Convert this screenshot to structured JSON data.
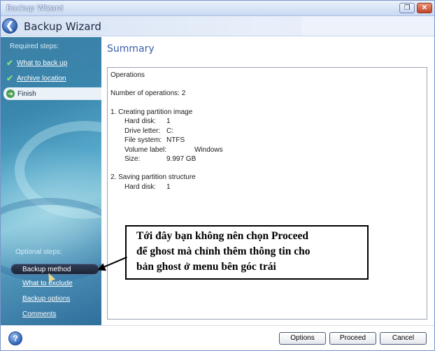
{
  "window": {
    "title": "Backup Wizard",
    "controls": {
      "restore": "❐",
      "close": "✕"
    }
  },
  "header": {
    "title": "Backup Wizard",
    "back_icon": "back-arrow-icon",
    "back_glyph": "❮"
  },
  "sidebar": {
    "required_label": "Required steps:",
    "required_items": [
      {
        "label": "What to back up",
        "icon": "check-icon"
      },
      {
        "label": "Archive location",
        "icon": "check-icon"
      }
    ],
    "current_step": {
      "label": "Finish",
      "icon": "arrow-right-icon",
      "glyph": "➜"
    },
    "optional_label": "Optional steps:",
    "optional_items": [
      {
        "label": "Backup method",
        "selected": true
      },
      {
        "label": "What to exclude"
      },
      {
        "label": "Backup options"
      },
      {
        "label": "Comments"
      }
    ],
    "check_glyph": "✔"
  },
  "main": {
    "title": "Summary",
    "operations_heading": "Operations",
    "operations_count": "Number of operations: 2",
    "op1": {
      "title": "1. Creating partition image",
      "rows": [
        {
          "k": "Hard disk:",
          "v": "1"
        },
        {
          "k": "Drive letter:",
          "v": "C:"
        },
        {
          "k": "File system:",
          "v": "NTFS"
        },
        {
          "k": "Volume label:",
          "v": "Windows"
        },
        {
          "k": "Size:",
          "v": "9.997 GB"
        }
      ]
    },
    "op2": {
      "title": "2. Saving partition structure",
      "rows": [
        {
          "k": "Hard disk:",
          "v": "1"
        }
      ]
    }
  },
  "annotation": {
    "line1": "Tới đây bạn không nên chọn Proceed",
    "line2": "để ghost mà chỉnh thêm thông tin cho",
    "line3": "bản ghost ở menu bên góc trái"
  },
  "footer": {
    "help_glyph": "?",
    "options": "Options",
    "proceed": "Proceed",
    "cancel": "Cancel"
  },
  "colors": {
    "accent": "#3a5ea8",
    "sidebar": "#3a86ad",
    "check": "#7fe07a"
  }
}
